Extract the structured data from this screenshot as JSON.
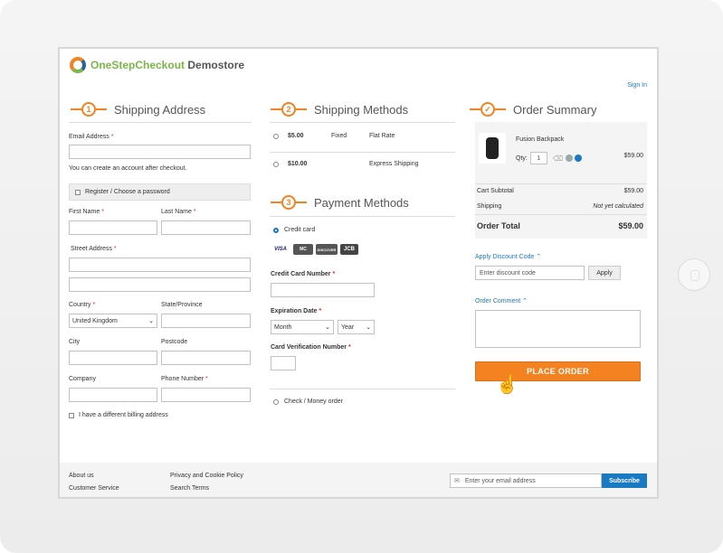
{
  "header": {
    "logo_brand": "OneStepCheckout",
    "logo_suffix": " Demostore",
    "signin": "Sign In"
  },
  "shipping_address": {
    "step": "1",
    "title": "Shipping Address",
    "email_label": "Email Address",
    "email_note": "You can create an account after checkout.",
    "register_label": "Register / Choose a password",
    "first_name_label": "First Name",
    "last_name_label": "Last Name",
    "street_label": "Street Address",
    "country_label": "Country",
    "country_value": "United Kingdom",
    "state_label": "State/Province",
    "city_label": "City",
    "postcode_label": "Postcode",
    "company_label": "Company",
    "phone_label": "Phone Number",
    "billing_label": "I have a different billing address",
    "required_mark": "*"
  },
  "shipping_methods": {
    "step": "2",
    "title": "Shipping Methods",
    "rows": [
      {
        "price": "$5.00",
        "carrier": "Fixed",
        "name": "Flat Rate"
      },
      {
        "price": "$10.00",
        "carrier": "",
        "name": "Express Shipping"
      }
    ]
  },
  "payment_methods": {
    "step": "3",
    "title": "Payment Methods",
    "credit_card_label": "Credit card",
    "cards": [
      "VISA",
      "MC",
      "DISCOVER",
      "JCB"
    ],
    "cc_number_label": "Credit Card Number",
    "expiration_label": "Expiration Date",
    "month_placeholder": "Month",
    "year_placeholder": "Year",
    "cvv_label": "Card Verification Number",
    "check_label": "Check / Money order"
  },
  "order_summary": {
    "step": "✓",
    "title": "Order Summary",
    "item_name": "Fusion Backpack",
    "qty_label": "Qty:",
    "qty_value": "1",
    "item_price": "$59.00",
    "cart_subtotal_label": "Cart Subtotal",
    "cart_subtotal_value": "$59.00",
    "shipping_label": "Shipping",
    "shipping_value": "Not yet calculated",
    "order_total_label": "Order Total",
    "order_total_value": "$59.00",
    "discount_label": "Apply Discount Code",
    "discount_placeholder": "Enter discount code",
    "apply_label": "Apply",
    "comment_label": "Order Comment",
    "place_order_label": "PLACE ORDER"
  },
  "footer": {
    "links_col1": [
      "About us",
      "Customer Service"
    ],
    "links_col2": [
      "Privacy and Cookie Policy",
      "Search Terms"
    ],
    "newsletter_placeholder": "Enter your email address",
    "subscribe_label": "Subscribe"
  },
  "colors": {
    "accent": "#f58220",
    "link": "#1979c3"
  }
}
